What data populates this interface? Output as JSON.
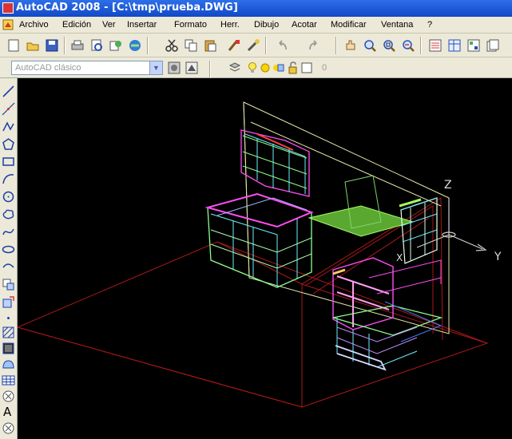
{
  "window": {
    "title": "AutoCAD 2008 - [C:\\tmp\\prueba.DWG]"
  },
  "menu": {
    "items": [
      "Archivo",
      "Edición",
      "Ver",
      "Insertar",
      "Formato",
      "Herr.",
      "Dibujo",
      "Acotar",
      "Modificar",
      "Ventana",
      "?"
    ]
  },
  "workspace": {
    "selected": "AutoCAD clásico"
  },
  "layer": {
    "current": "0"
  },
  "ucs": {
    "z_label": "Z",
    "y_label": "Y",
    "x_label": "X"
  },
  "left_toolbar": {
    "text_tool": "A"
  },
  "colors": {
    "title_blue": "#1148c7",
    "chrome": "#ece9d8",
    "model_red": "#b01818",
    "wire_green": "#8cff8c",
    "wire_cyan": "#6ef0ff",
    "wire_magenta": "#ff4df5"
  }
}
